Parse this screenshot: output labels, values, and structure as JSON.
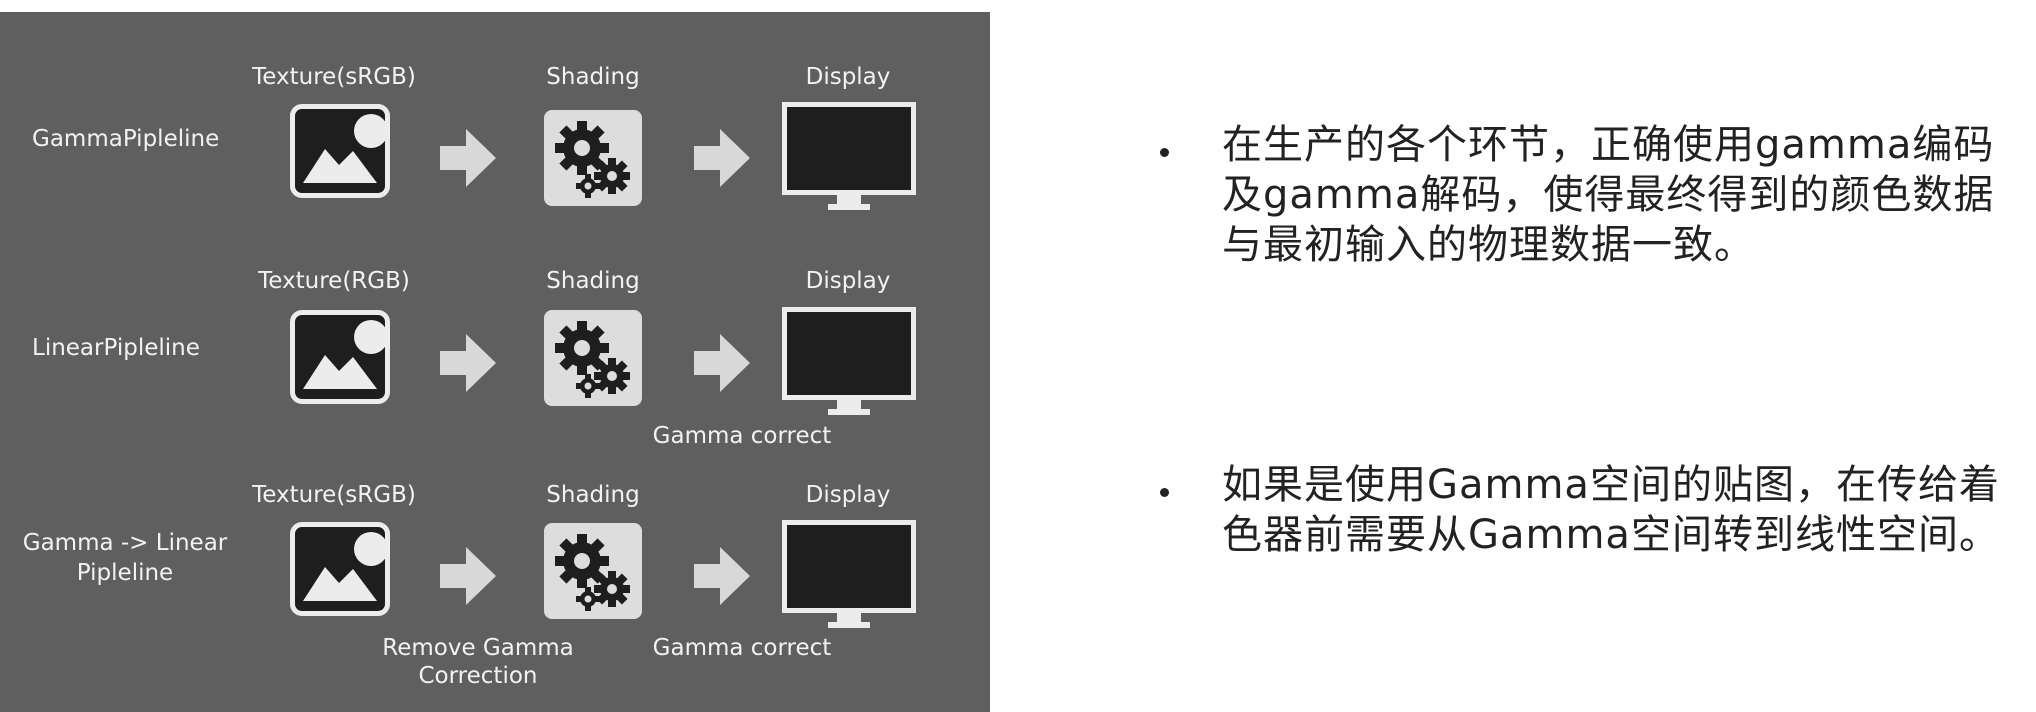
{
  "diagram": {
    "rows": [
      {
        "pipeline": "GammaPipleline",
        "stages": [
          "Texture(sRGB)",
          "Shading",
          "Display"
        ],
        "notes": []
      },
      {
        "pipeline": "LinearPipleline",
        "stages": [
          "Texture(RGB)",
          "Shading",
          "Display"
        ],
        "notes": [
          "Gamma correct"
        ]
      },
      {
        "pipeline": "Gamma -> Linear Pipleline",
        "stages": [
          "Texture(sRGB)",
          "Shading",
          "Display"
        ],
        "notes": [
          "Remove Gamma Correction",
          "Gamma correct"
        ]
      }
    ],
    "icons": {
      "texture": "image-icon",
      "shading": "gears-icon",
      "display": "monitor-icon",
      "arrow": "arrow-right-icon"
    },
    "colors": {
      "panel": "#5f5f5f",
      "text": "#f2f2f2",
      "arrow": "#d8d8d8",
      "screen": "#1e1e1e"
    }
  },
  "bullets": [
    "在生产的各个环节，正确使用gamma编码及gamma解码，使得最终得到的颜色数据与最初输入的物理数据一致。",
    "如果是使用Gamma空间的贴图，在传给着色器前需要从Gamma空间转到线性空间。"
  ]
}
